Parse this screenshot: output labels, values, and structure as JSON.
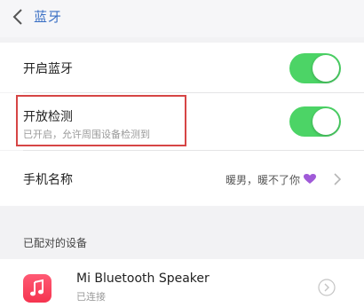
{
  "nav": {
    "back_icon": "chevron-left-icon",
    "title": "蓝牙"
  },
  "bluetooth_row": {
    "label": "开启蓝牙",
    "enabled": true
  },
  "discoverable_row": {
    "label": "开放检测",
    "sublabel": "已开启，允许周围设备检测到",
    "enabled": true
  },
  "device_name_row": {
    "label": "手机名称",
    "value": "暖男，暖不了你",
    "value_icon": "purple-heart-icon",
    "chevron_icon": "chevron-right-icon"
  },
  "paired_section": {
    "header": "已配对的设备",
    "devices": [
      {
        "name": "Mi Bluetooth Speaker",
        "status": "已连接",
        "icon": "music-app-icon",
        "detail_icon": "circle-chevron-icon"
      }
    ]
  },
  "colors": {
    "accent": "#3a6fc4",
    "toggle_on": "#4cd466",
    "highlight": "#d64545",
    "heart": "#a05ad8",
    "app_icon": "#f5344f"
  }
}
